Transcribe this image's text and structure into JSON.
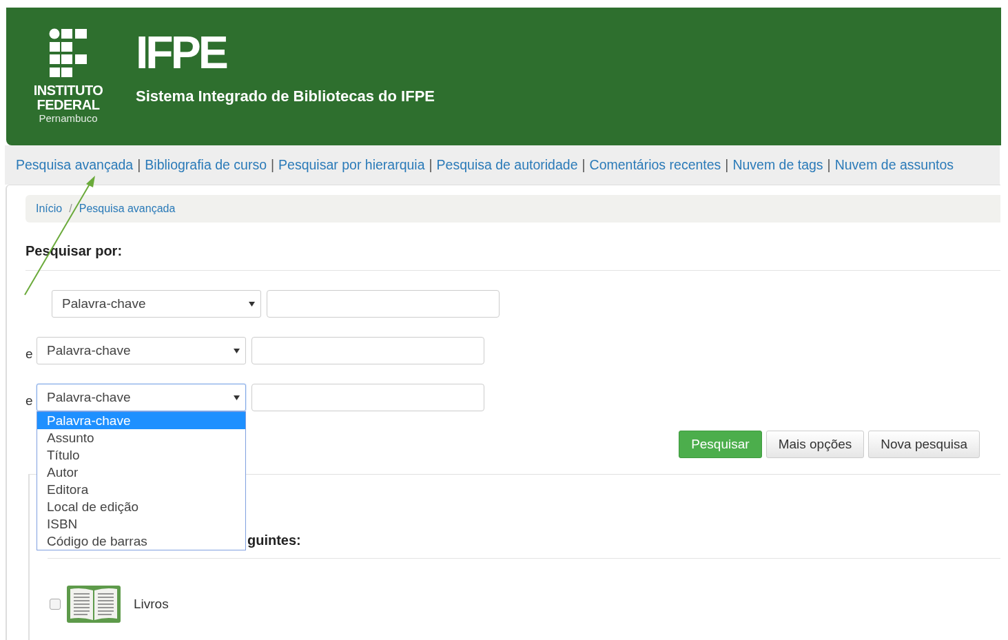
{
  "header": {
    "logo_lines": [
      "INSTITUTO",
      "FEDERAL",
      "Pernambuco"
    ],
    "title": "IFPE",
    "subtitle": "Sistema Integrado de Bibliotecas do IFPE"
  },
  "nav": {
    "separator": "|",
    "links": [
      "Pesquisa avançada",
      "Bibliografia de curso",
      "Pesquisar por hierarquia",
      "Pesquisa de autoridade",
      "Comentários recentes",
      "Nuvem de tags",
      "Nuvem de assuntos"
    ]
  },
  "breadcrumb": {
    "separator": "/",
    "items": [
      "Início",
      "Pesquisa avançada"
    ]
  },
  "search_heading": "Pesquisar por:",
  "rows": [
    {
      "connector": "",
      "select": "Palavra-chave",
      "focused": false
    },
    {
      "connector": "e",
      "select": "Palavra-chave",
      "focused": false
    },
    {
      "connector": "e",
      "select": "Palavra-chave",
      "focused": true
    }
  ],
  "dropdown": {
    "options": [
      {
        "label": "Palavra-chave",
        "selected": true
      },
      {
        "label": "Assunto",
        "selected": false
      },
      {
        "label": "Título",
        "selected": false
      },
      {
        "label": "Autor",
        "selected": false
      },
      {
        "label": "Editora",
        "selected": false
      },
      {
        "label": "Local de edição",
        "selected": false
      },
      {
        "label": "ISBN",
        "selected": false
      },
      {
        "label": "Código de barras",
        "selected": false
      }
    ]
  },
  "buttons": [
    {
      "label": "Pesquisar",
      "kind": "primary"
    },
    {
      "label": "Mais opções",
      "kind": "default"
    },
    {
      "label": "Nova pesquisa",
      "kind": "default"
    }
  ],
  "types_heading": "guintes:",
  "material_types": [
    {
      "label": "Livros",
      "checked": false
    }
  ]
}
